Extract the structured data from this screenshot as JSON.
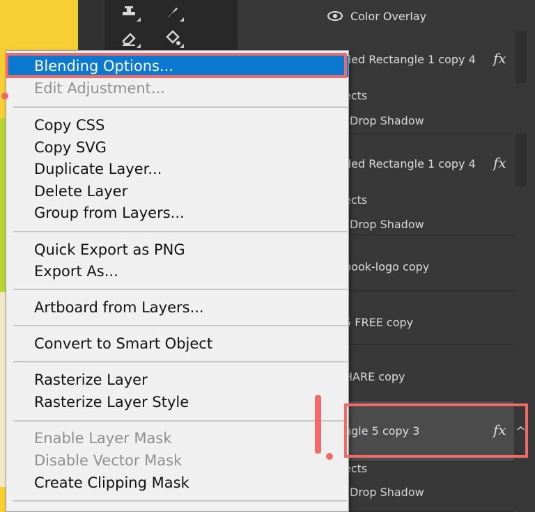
{
  "colors": {
    "accent_red": "#f16a6a",
    "menu_selected": "#0b79d0",
    "panel_dark": "#383838",
    "menu_bg": "#f0f0f0"
  },
  "toolbar": {
    "icons": [
      "stamp-icon",
      "brush-icon",
      "eraser-icon",
      "paint-bucket-icon"
    ]
  },
  "layers_panel": {
    "color_overlay": "Color Overlay",
    "rows": [
      {
        "name": "ded Rectangle 1 copy 4",
        "fx": "fx",
        "caret": "^",
        "effects": "ects",
        "drop_shadow": "Drop Shadow"
      },
      {
        "name": "ded Rectangle 1 copy 4",
        "fx": "fx",
        "caret": "^",
        "effects": "ects",
        "drop_shadow": "Drop Shadow"
      },
      {
        "name": "book-logo copy"
      },
      {
        "name": "5 FREE copy"
      },
      {
        "name": "HARE copy"
      },
      {
        "name": "ngle 5 copy 3",
        "fx": "fx",
        "caret": "^",
        "effects": "ects",
        "drop_shadow": "Drop Shadow"
      }
    ]
  },
  "annotation": {
    "step_label": "1."
  },
  "context_menu": {
    "items": [
      {
        "label": "Blending Options...",
        "state": "selected"
      },
      {
        "label": "Edit Adjustment...",
        "state": "disabled"
      },
      {
        "label": "Copy CSS",
        "state": "enabled"
      },
      {
        "label": "Copy SVG",
        "state": "enabled"
      },
      {
        "label": "Duplicate Layer...",
        "state": "enabled"
      },
      {
        "label": "Delete Layer",
        "state": "enabled"
      },
      {
        "label": "Group from Layers...",
        "state": "enabled"
      },
      {
        "label": "Quick Export as PNG",
        "state": "enabled"
      },
      {
        "label": "Export As...",
        "state": "enabled"
      },
      {
        "label": "Artboard from Layers...",
        "state": "enabled"
      },
      {
        "label": "Convert to Smart Object",
        "state": "enabled"
      },
      {
        "label": "Rasterize Layer",
        "state": "enabled"
      },
      {
        "label": "Rasterize Layer Style",
        "state": "enabled"
      },
      {
        "label": "Enable Layer Mask",
        "state": "disabled"
      },
      {
        "label": "Disable Vector Mask",
        "state": "disabled"
      },
      {
        "label": "Create Clipping Mask",
        "state": "enabled"
      }
    ]
  }
}
